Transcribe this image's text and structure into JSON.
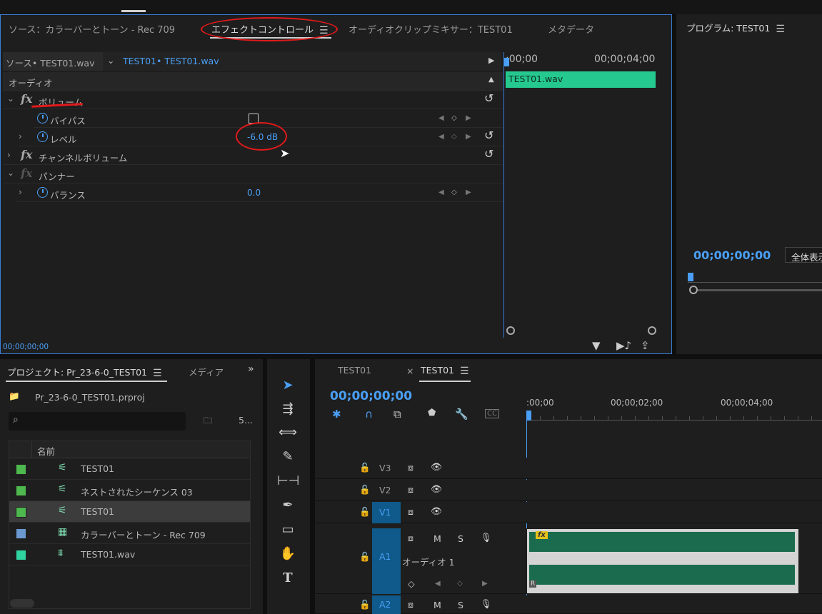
{
  "effect_panel": {
    "tabs": {
      "source": "ソース：カラーバーとトーン - Rec 709",
      "effect_controls": "エフェクトコントロール",
      "audio_mixer": "オーディオクリップミキサー：TEST01",
      "metadata": "メタデータ"
    },
    "source_selector": "ソース• TEST01.wav",
    "sequence_selector": "TEST01• TEST01.wav",
    "section": "オーディオ",
    "mini_timeline": {
      "start": ":00;00",
      "end": "00;00;04;00",
      "clip": "TEST01.wav"
    },
    "effects": {
      "volume": "ボリューム",
      "bypass": "バイパス",
      "level": "レベル",
      "level_value": "-6.0",
      "level_unit": "dB",
      "channel_volume": "チャンネルボリューム",
      "panner": "パンナー",
      "balance": "バランス",
      "balance_value": "0.0"
    },
    "footer_timecode": "00;00;00;00"
  },
  "program_monitor": {
    "title": "プログラム: TEST01",
    "timecode": "00;00;00;00",
    "fit_label": "全体表示"
  },
  "project_panel": {
    "tab": "プロジェクト: Pr_23-6-0_TEST01",
    "media_tab": "メディア",
    "file": "Pr_23-6-0_TEST01.prproj",
    "count": "5...",
    "column_name": "名前",
    "items": [
      {
        "name": "TEST01",
        "color": "#4db84d",
        "icon": "sequence-icon"
      },
      {
        "name": "ネストされたシーケンス 03",
        "color": "#4db84d",
        "icon": "sequence-icon"
      },
      {
        "name": "TEST01",
        "color": "#4db84d",
        "icon": "sequence-icon"
      },
      {
        "name": "カラーバーとトーン - Rec 709",
        "color": "#6a98d0",
        "icon": "bars-tone-icon"
      },
      {
        "name": "TEST01.wav",
        "color": "#2fd3a0",
        "icon": "audio-clip-icon"
      }
    ]
  },
  "timeline": {
    "tab1": "TEST01",
    "tab2": "TEST01",
    "timecode": "00;00;00;00",
    "ruler": [
      ":00;00",
      "00;00;02;00",
      "00;00;04;00"
    ],
    "tracks": {
      "v3": "V3",
      "v2": "V2",
      "v1": "V1",
      "a1": "A1",
      "a2": "A2",
      "audio1_name": "オーディオ 1",
      "mute": "M",
      "solo": "S"
    },
    "clip_fx_badge": "fx",
    "clip_channel_right": "R"
  },
  "colors": {
    "accent_blue": "#4a9ff5",
    "clip_green": "#25c98f",
    "track_green": "#1b6c4e",
    "annotation_red": "#e3191b"
  }
}
